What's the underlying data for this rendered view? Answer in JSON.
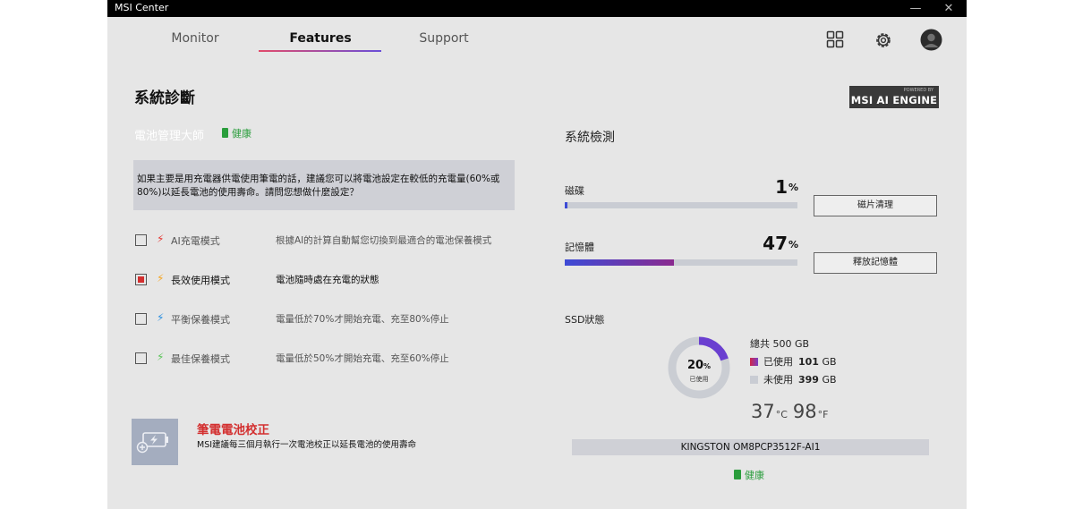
{
  "app": {
    "title": "MSI Center",
    "minimize_glyph": "—",
    "close_glyph": "✕"
  },
  "nav": {
    "tabs": [
      {
        "label": "Monitor"
      },
      {
        "label": "Features"
      },
      {
        "label": "Support"
      }
    ],
    "active": "Features"
  },
  "header_icons": [
    "grid-icon",
    "gear-icon",
    "avatar-icon"
  ],
  "page": {
    "title": "系統診斷"
  },
  "badge": {
    "powered_by": "POWERED BY",
    "engine": "MSI AI ENGINE"
  },
  "battery": {
    "title": "電池管理大師",
    "health": "健康",
    "question": "如果主要是用充電器供電使用筆電的話，建議您可以將電池設定在較低的充電量(60%或80%)以延長電池的使用壽命。請問您想做什麼設定？",
    "options": [
      {
        "label": "AI充電模式",
        "desc": "根據AI的計算自動幫您切換到最適合的電池保養模式",
        "checked": false,
        "bolt_color": "#e53935"
      },
      {
        "label": "長效使用模式",
        "desc": "電池隨時處在充電的狀態",
        "checked": true,
        "bolt_color": "#f5a623"
      },
      {
        "label": "平衡保養模式",
        "desc": "電量低於70%才開始充電、充至80%停止",
        "checked": false,
        "bolt_color": "#2a8fe0"
      },
      {
        "label": "最佳保養模式",
        "desc": "電量低於50%才開始充電、充至60%停止",
        "checked": false,
        "bolt_color": "#5cc55a"
      }
    ],
    "calibration": {
      "title": "筆電電池校正",
      "desc": "MSI建議每三個月執行一次電池校正以延長電池的使用壽命"
    }
  },
  "system": {
    "title": "系統檢測",
    "disk": {
      "label": "磁碟",
      "value": "1",
      "unit": "%",
      "fraction": 0.01,
      "button": "磁片清理"
    },
    "memory": {
      "label": "記憶體",
      "value": "47",
      "unit": "%",
      "fraction": 0.47,
      "button": "釋放記憶體"
    }
  },
  "ssd": {
    "title": "SSD狀態",
    "donut_percent": "20",
    "donut_unit": "%",
    "donut_fraction": 0.2,
    "used_short": "已使用",
    "total": "總共 500 GB",
    "used_label": "已使用",
    "used_value": "101",
    "used_unit": "GB",
    "free_label": "未使用",
    "free_value": "399",
    "free_unit": "GB",
    "temp_c": "37",
    "temp_c_unit": "°C",
    "temp_f": "98",
    "temp_f_unit": "°F",
    "model": "KINGSTON OM8PCP3512F-AI1",
    "health": "健康"
  },
  "colors": {
    "accent_start": "#e24b6b",
    "accent_end": "#6a4fd8",
    "healthy": "#2a9d3c",
    "bar_blue": "#3d4bd6",
    "bar_purple": "#8a2a8f",
    "used_swatch": "#7a3fc4",
    "free_swatch": "#c9ccd3"
  }
}
